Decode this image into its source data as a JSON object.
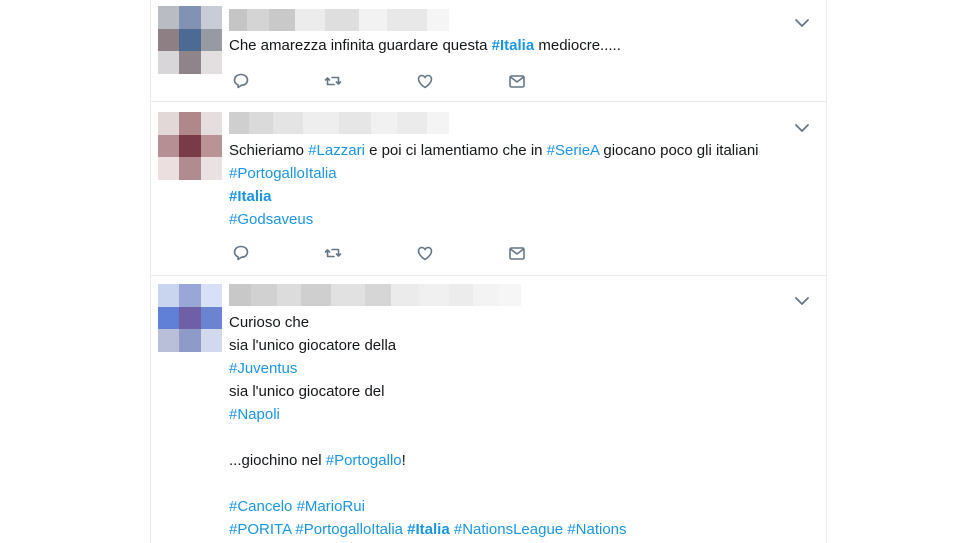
{
  "tweets": [
    {
      "lines": [
        [
          {
            "t": "Che amarezza infinita guardare questa ",
            "k": "text"
          },
          {
            "t": "#Italia",
            "k": "tag-bold"
          },
          {
            "t": " mediocre.....",
            "k": "text"
          }
        ]
      ]
    },
    {
      "lines": [
        [
          {
            "t": "Schieriamo ",
            "k": "text"
          },
          {
            "t": "#Lazzari",
            "k": "tag"
          },
          {
            "t": " e poi ci lamentiamo che in ",
            "k": "text"
          },
          {
            "t": "#SerieA",
            "k": "tag"
          },
          {
            "t": " giocano poco gli italiani",
            "k": "text"
          }
        ],
        [
          {
            "t": "#PortogalloItalia",
            "k": "tag"
          }
        ],
        [
          {
            "t": "#Italia",
            "k": "tag-bold"
          }
        ],
        [
          {
            "t": "#Godsaveus",
            "k": "tag"
          }
        ]
      ]
    },
    {
      "lines": [
        [
          {
            "t": "Curioso che",
            "k": "text"
          }
        ],
        [
          {
            "t": "sia l'unico giocatore della",
            "k": "text"
          }
        ],
        [
          {
            "t": "#Juventus",
            "k": "tag"
          }
        ],
        [
          {
            "t": "sia l'unico giocatore del",
            "k": "text"
          }
        ],
        [
          {
            "t": "#Napoli",
            "k": "tag"
          }
        ],
        [],
        [
          {
            "t": "...giochino nel ",
            "k": "text"
          },
          {
            "t": "#Portogallo",
            "k": "tag"
          },
          {
            "t": "!",
            "k": "text"
          }
        ],
        [],
        [
          {
            "t": "#Cancelo",
            "k": "tag"
          },
          {
            "t": " ",
            "k": "text"
          },
          {
            "t": "#MarioRui",
            "k": "tag"
          }
        ],
        [
          {
            "t": "#PORITA",
            "k": "tag"
          },
          {
            "t": " ",
            "k": "text"
          },
          {
            "t": "#PortogalloItalia",
            "k": "tag"
          },
          {
            "t": " ",
            "k": "text"
          },
          {
            "t": "#Italia",
            "k": "tag-bold"
          },
          {
            "t": " ",
            "k": "text"
          },
          {
            "t": "#NationsLeague",
            "k": "tag"
          },
          {
            "t": " ",
            "k": "text"
          },
          {
            "t": "#Nations",
            "k": "tag"
          }
        ]
      ]
    }
  ],
  "actions": [
    "reply-icon",
    "retweet-icon",
    "like-icon",
    "direct-message-icon"
  ],
  "colors": {
    "hashtag": "#1b95e0",
    "text": "#14171a",
    "icon": "#657786",
    "divider": "#e6ecf0"
  }
}
